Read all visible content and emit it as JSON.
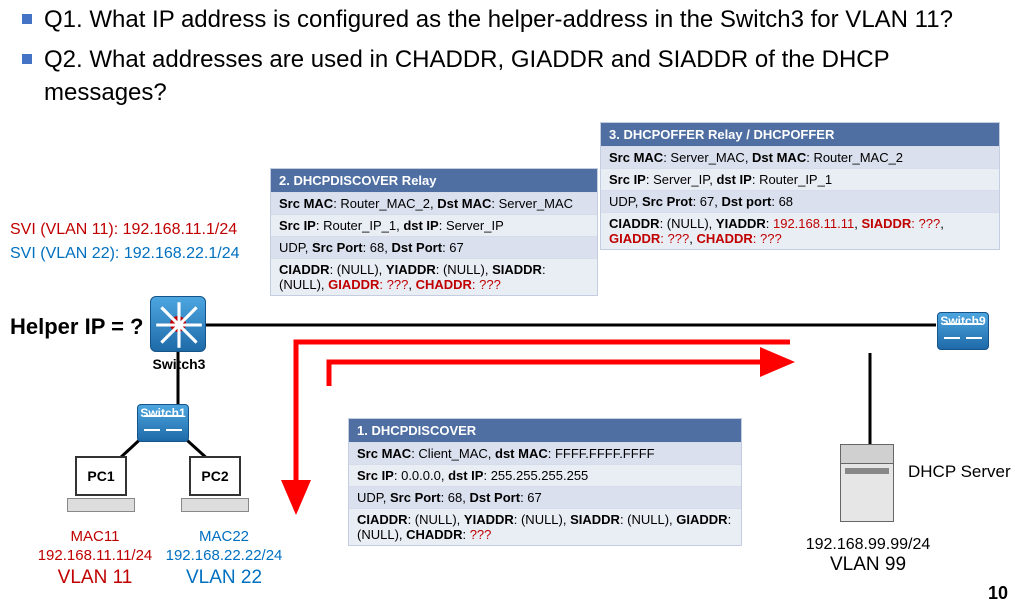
{
  "questions": {
    "q1": "Q1. What IP address is configured as the helper-address in the Switch3 for VLAN 11?",
    "q2": "Q2. What addresses are used in CHADDR, GIADDR and SIADDR of the DHCP messages?"
  },
  "svi": {
    "v11": "SVI (VLAN 11): 192.168.11.1/24",
    "v22": "SVI (VLAN 22): 192.168.22.1/24"
  },
  "helper_label": "Helper IP = ?",
  "tables": {
    "discover": {
      "title": "1. DHCPDISCOVER",
      "lines": [
        {
          "t": "Src MAC: Client_MAC, dst MAC: FFFF.FFFF.FFFF",
          "bold": [
            "Src MAC",
            "dst MAC"
          ]
        },
        {
          "t": "Src IP: 0.0.0.0, dst IP: 255.255.255.255",
          "bold": [
            "Src IP",
            "dst IP"
          ]
        },
        {
          "t": "UDP, Src Port: 68, Dst Port: 67",
          "bold": [
            "Src Port",
            "Dst Port"
          ]
        },
        {
          "t": "CIADDR: (NULL), YIADDR: (NULL), SIADDR: (NULL), GIADDR: (NULL), CHADDR: ???",
          "bold": [
            "CIADDR",
            "YIADDR",
            "SIADDR",
            "GIADDR",
            "CHADDR"
          ],
          "red": [
            "???"
          ]
        }
      ]
    },
    "relay": {
      "title": "2. DHCPDISCOVER Relay",
      "lines": [
        {
          "t": "Src MAC: Router_MAC_2, Dst MAC: Server_MAC",
          "bold": [
            "Src MAC",
            "Dst MAC"
          ]
        },
        {
          "t": "Src IP: Router_IP_1, dst IP: Server_IP",
          "bold": [
            "Src IP",
            "dst IP"
          ]
        },
        {
          "t": "UDP, Src Port: 68, Dst Port: 67",
          "bold": [
            "Src Port",
            "Dst Port"
          ]
        },
        {
          "t": "CIADDR: (NULL), YIADDR: (NULL), SIADDR: (NULL), GIADDR: ???, CHADDR: ???",
          "bold": [
            "CIADDR",
            "YIADDR",
            "SIADDR",
            "GIADDR",
            "CHADDR"
          ],
          "red": [
            "GIADDR: ???",
            "CHADDR: ???"
          ]
        }
      ]
    },
    "offer": {
      "title": "3. DHCPOFFER Relay / DHCPOFFER",
      "lines": [
        {
          "t": "Src MAC: Server_MAC, Dst MAC: Router_MAC_2",
          "bold": [
            "Src MAC",
            "Dst MAC"
          ]
        },
        {
          "t": "Src IP: Server_IP, dst IP: Router_IP_1",
          "bold": [
            "Src IP",
            "dst IP"
          ]
        },
        {
          "t": "UDP, Src Prot: 67, Dst port: 68",
          "bold": [
            "Src Prot",
            "Dst port"
          ]
        },
        {
          "t": "CIADDR: (NULL), YIADDR: 192.168.11.11, SIADDR: ???, GIADDR: ???, CHADDR: ???",
          "bold": [
            "CIADDR",
            "YIADDR",
            "SIADDR",
            "GIADDR",
            "CHADDR"
          ],
          "red": [
            "192.168.11.11",
            "SIADDR: ???",
            "GIADDR: ???",
            "CHADDR: ???"
          ]
        }
      ]
    }
  },
  "devices": {
    "switch3": "Switch3",
    "switch1": "Switch1",
    "switch9": "Switch9",
    "pc1": "PC1",
    "pc2": "PC2",
    "dhcp_server": "DHCP Server"
  },
  "pc_meta": {
    "pc1": {
      "mac": "MAC11",
      "ip": "192.168.11.11/24",
      "vlan": "VLAN 11"
    },
    "pc2": {
      "mac": "MAC22",
      "ip": "192.168.22.22/24",
      "vlan": "VLAN 22"
    }
  },
  "server_meta": {
    "ip": "192.168.99.99/24",
    "vlan": "VLAN 99"
  },
  "slide_number": "10"
}
